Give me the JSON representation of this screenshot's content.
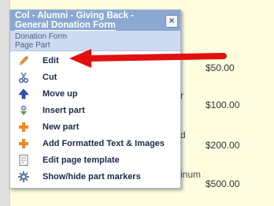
{
  "background_page": {
    "fragments": [
      "r",
      "d",
      "inum"
    ],
    "amounts": [
      "$50.00",
      "$100.00",
      "$200.00",
      "$500.00"
    ]
  },
  "context_menu": {
    "title_line1": "Col - Alumni - Giving Back -",
    "title_line2": "General Donation Form",
    "close_glyph": "×",
    "subtitle_line1": "Donation Form",
    "subtitle_line2": "Page Part",
    "items": [
      {
        "label": "Edit",
        "icon": "pencil-icon"
      },
      {
        "label": "Cut",
        "icon": "scissors-icon"
      },
      {
        "label": "Move up",
        "icon": "arrow-up-icon"
      },
      {
        "label": "Insert part",
        "icon": "insert-part-icon"
      },
      {
        "label": "New part",
        "icon": "plus-icon"
      },
      {
        "label": "Add Formatted Text & Images",
        "icon": "plus-icon"
      },
      {
        "label": "Edit page template",
        "icon": "page-template-icon"
      },
      {
        "label": "Show/hide part markers",
        "icon": "gear-icon"
      }
    ]
  },
  "colors": {
    "page_background": "#fefde0",
    "menu_header": "#8aa8d2",
    "menu_subheader": "#cfdaf0",
    "annotation_arrow": "#e01010"
  }
}
